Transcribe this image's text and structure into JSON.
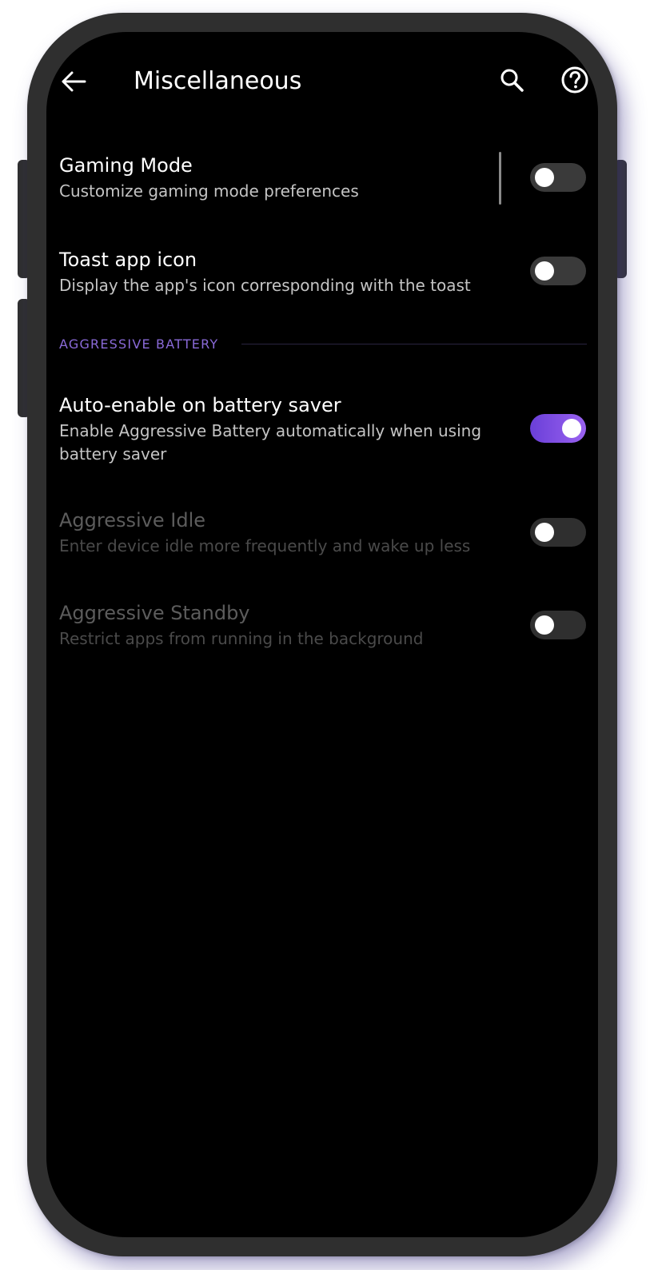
{
  "app_bar": {
    "title": "Miscellaneous",
    "back_icon": "arrow-back-icon",
    "search_icon": "search-icon",
    "help_icon": "help-circle-icon"
  },
  "preferences": [
    {
      "title": "Gaming Mode",
      "summary": "Customize gaming mode preferences",
      "switch_on": false,
      "enabled": true
    },
    {
      "title": "Toast app icon",
      "summary": "Display the app's icon corresponding with the toast",
      "switch_on": false,
      "enabled": true
    }
  ],
  "aggressive_battery": {
    "header": "AGGRESSIVE BATTERY",
    "items": [
      {
        "title": "Auto-enable on battery saver",
        "summary": "Enable Aggressive Battery automatically when using battery saver",
        "switch_on": true,
        "enabled": true
      },
      {
        "title": "Aggressive Idle",
        "summary": "Enter device idle more frequently and wake up less",
        "switch_on": false,
        "enabled": false
      },
      {
        "title": "Aggressive Standby",
        "summary": "Restrict apps from running in the background",
        "switch_on": false,
        "enabled": false
      }
    ]
  },
  "colors": {
    "accent": "#8b5cf6",
    "section_header": "#8a6ad8",
    "background": "#000000",
    "phone_frame": "#2f2f2f"
  }
}
